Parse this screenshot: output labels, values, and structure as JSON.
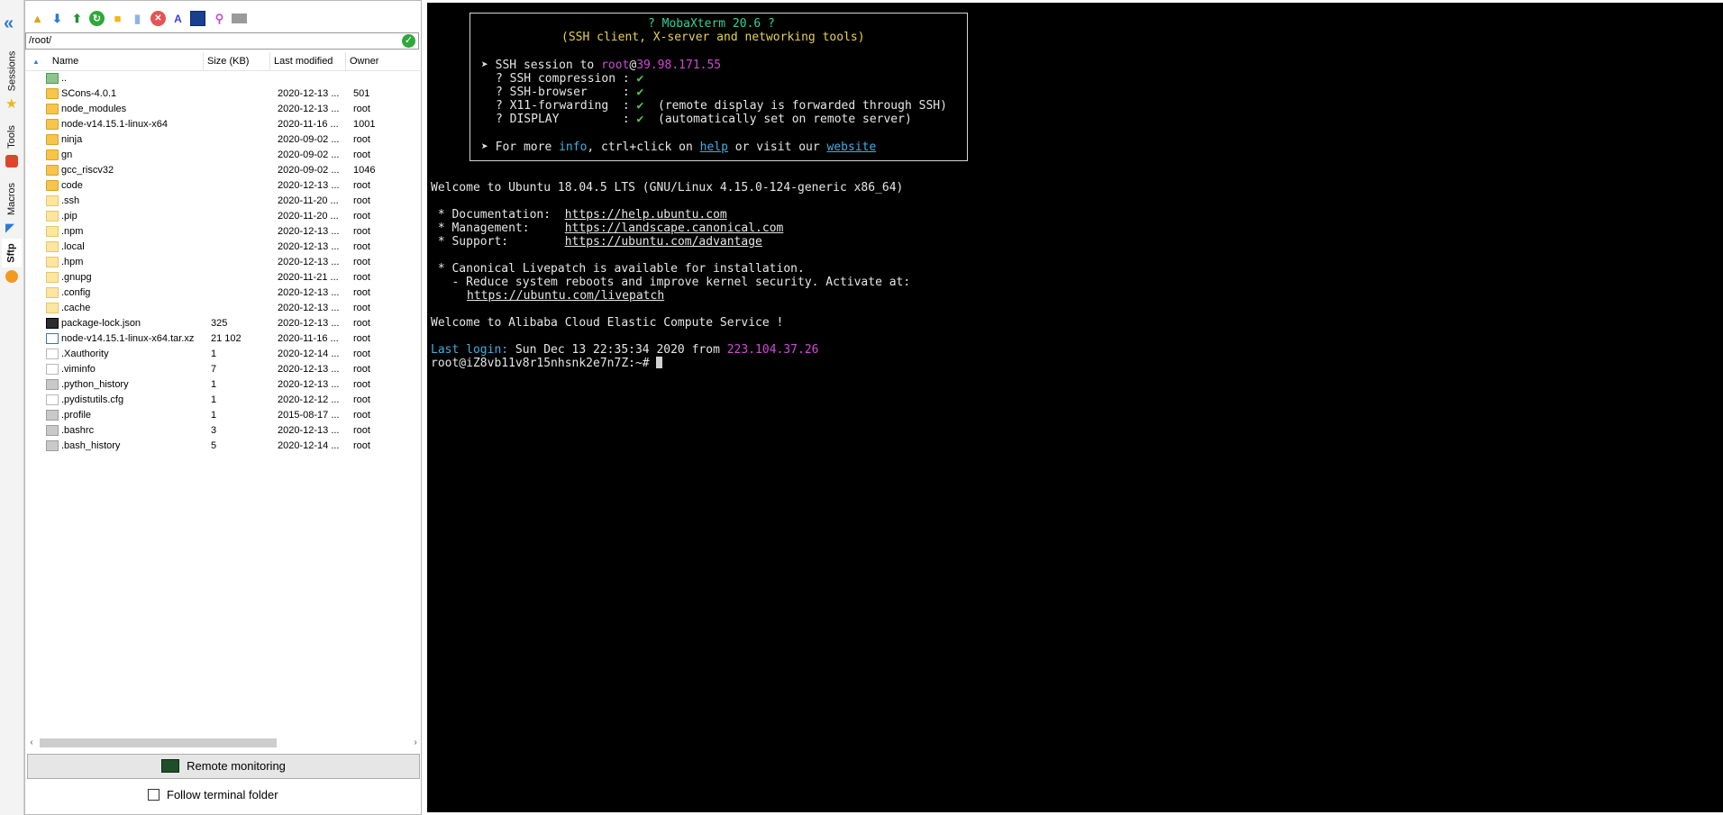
{
  "side_tabs": {
    "sessions": "Sessions",
    "tools": "Tools",
    "macros": "Macros",
    "sftp": "Sftp"
  },
  "sftp": {
    "path": "/root/",
    "columns": {
      "name": "Name",
      "size": "Size (KB)",
      "modified": "Last modified",
      "owner": "Owner"
    },
    "files": [
      {
        "name": "..",
        "size": "",
        "modified": "",
        "owner": "",
        "icon": "parent-folder-icon"
      },
      {
        "name": "SCons-4.0.1",
        "size": "",
        "modified": "2020-12-13 ...",
        "owner": "501",
        "icon": "folder-icon"
      },
      {
        "name": "node_modules",
        "size": "",
        "modified": "2020-12-13 ...",
        "owner": "root",
        "icon": "folder-icon"
      },
      {
        "name": "node-v14.15.1-linux-x64",
        "size": "",
        "modified": "2020-11-16 ...",
        "owner": "1001",
        "icon": "folder-icon"
      },
      {
        "name": "ninja",
        "size": "",
        "modified": "2020-09-02 ...",
        "owner": "root",
        "icon": "folder-icon"
      },
      {
        "name": "gn",
        "size": "",
        "modified": "2020-09-02 ...",
        "owner": "root",
        "icon": "folder-icon"
      },
      {
        "name": "gcc_riscv32",
        "size": "",
        "modified": "2020-09-02 ...",
        "owner": "1046",
        "icon": "folder-icon"
      },
      {
        "name": "code",
        "size": "",
        "modified": "2020-12-13 ...",
        "owner": "root",
        "icon": "folder-icon"
      },
      {
        "name": ".ssh",
        "size": "",
        "modified": "2020-11-20 ...",
        "owner": "root",
        "icon": "hidden-folder-icon"
      },
      {
        "name": ".pip",
        "size": "",
        "modified": "2020-11-20 ...",
        "owner": "root",
        "icon": "hidden-folder-icon"
      },
      {
        "name": ".npm",
        "size": "",
        "modified": "2020-12-13 ...",
        "owner": "root",
        "icon": "hidden-folder-icon"
      },
      {
        "name": ".local",
        "size": "",
        "modified": "2020-12-13 ...",
        "owner": "root",
        "icon": "hidden-folder-icon"
      },
      {
        "name": ".hpm",
        "size": "",
        "modified": "2020-12-13 ...",
        "owner": "root",
        "icon": "hidden-folder-icon"
      },
      {
        "name": ".gnupg",
        "size": "",
        "modified": "2020-11-21 ...",
        "owner": "root",
        "icon": "hidden-folder-icon"
      },
      {
        "name": ".config",
        "size": "",
        "modified": "2020-12-13 ...",
        "owner": "root",
        "icon": "hidden-folder-icon"
      },
      {
        "name": ".cache",
        "size": "",
        "modified": "2020-12-13 ...",
        "owner": "root",
        "icon": "hidden-folder-icon"
      },
      {
        "name": "package-lock.json",
        "size": "325",
        "modified": "2020-12-13 ...",
        "owner": "root",
        "icon": "json-file-icon"
      },
      {
        "name": "node-v14.15.1-linux-x64.tar.xz",
        "size": "21 102",
        "modified": "2020-11-16 ...",
        "owner": "root",
        "icon": "archive-file-icon"
      },
      {
        "name": ".Xauthority",
        "size": "1",
        "modified": "2020-12-14 ...",
        "owner": "root",
        "icon": "file-icon"
      },
      {
        "name": ".viminfo",
        "size": "7",
        "modified": "2020-12-13 ...",
        "owner": "root",
        "icon": "text-file-icon"
      },
      {
        "name": ".python_history",
        "size": "1",
        "modified": "2020-12-13 ...",
        "owner": "root",
        "icon": "gray-file-icon"
      },
      {
        "name": ".pydistutils.cfg",
        "size": "1",
        "modified": "2020-12-12 ...",
        "owner": "root",
        "icon": "text-file-icon"
      },
      {
        "name": ".profile",
        "size": "1",
        "modified": "2015-08-17 ...",
        "owner": "root",
        "icon": "gray-file-icon"
      },
      {
        "name": ".bashrc",
        "size": "3",
        "modified": "2020-12-13 ...",
        "owner": "root",
        "icon": "gray-file-icon"
      },
      {
        "name": ".bash_history",
        "size": "5",
        "modified": "2020-12-14 ...",
        "owner": "root",
        "icon": "gray-file-icon"
      }
    ],
    "remote_monitoring_label": "Remote monitoring",
    "follow_terminal_label": "Follow terminal folder",
    "follow_terminal_checked": false
  },
  "terminal": {
    "banner_title": "? MobaXterm 20.6 ?",
    "banner_subtitle": "(SSH client, X-server and networking tools)",
    "ssh_session_prefix": "➤ SSH session to ",
    "ssh_user": "root",
    "ssh_at": "@",
    "ssh_host": "39.98.171.55",
    "opt1_label": "? SSH compression : ",
    "opt2_label": "? SSH-browser     : ",
    "opt3_label": "? X11-forwarding  : ",
    "opt3_note": "  (remote display is forwarded through SSH)",
    "opt4_label": "? DISPLAY         : ",
    "opt4_note": "  (automatically set on remote server)",
    "check": "✔",
    "more_prefix": "➤ For more ",
    "more_info": "info",
    "more_mid": ", ctrl+click on ",
    "more_help": "help",
    "more_mid2": " or visit our ",
    "more_website": "website",
    "welcome_ubuntu": "Welcome to Ubuntu 18.04.5 LTS (GNU/Linux 4.15.0-124-generic x86_64)",
    "doc_label": " * Documentation:  ",
    "doc_url": "https://help.ubuntu.com",
    "mgmt_label": " * Management:     ",
    "mgmt_url": "https://landscape.canonical.com",
    "support_label": " * Support:        ",
    "support_url": "https://ubuntu.com/advantage",
    "livepatch_line": " * Canonical Livepatch is available for installation.",
    "livepatch_line2": "   - Reduce system reboots and improve kernel security. Activate at:",
    "livepatch_url": "https://ubuntu.com/livepatch",
    "welcome_alibaba": "Welcome to Alibaba Cloud Elastic Compute Service !",
    "last_login_label": "Last login:",
    "last_login_date": " Sun Dec 13 22:35:34 2020 from ",
    "last_login_ip": "223.104.37.26",
    "prompt": "root@iZ8vb11v8r15nhsnk2e7n7Z:~# "
  }
}
